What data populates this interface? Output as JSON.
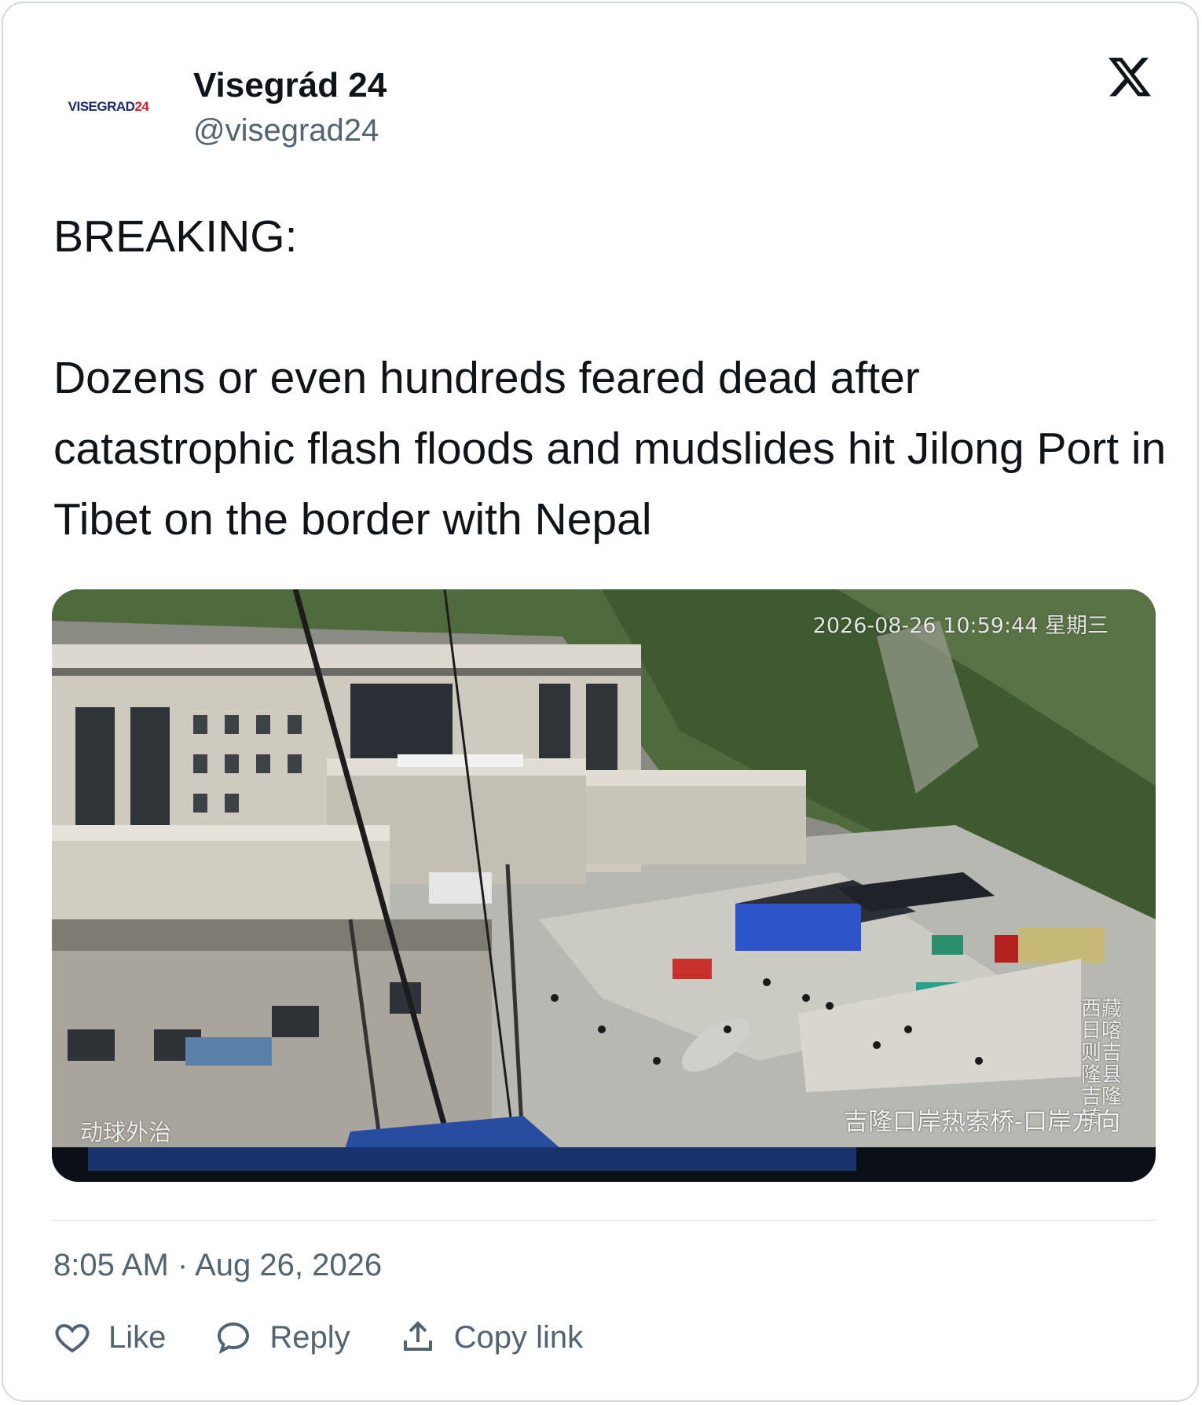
{
  "author": {
    "avatar_text": "VISEGRAD",
    "avatar_num": "24",
    "name": "Visegrád 24",
    "handle": "@visegrad24"
  },
  "platform_icon": "x-logo-icon",
  "tweet": {
    "line1": "BREAKING:",
    "line2": "Dozens or even hundreds feared dead after catastrophic flash floods and mudslides hit Jilong Port in Tibet on the border with Nepal"
  },
  "media": {
    "camera_timestamp": "2026-08-26 10:59:44 星期三",
    "label_left": "动球外治",
    "label_right": "吉隆口岸热索桥-口岸方向",
    "label_place": "西藏日喀则吉隆县吉隆镇",
    "progress": 0.72
  },
  "footer": {
    "timestamp": "8:05 AM · Aug 26, 2026"
  },
  "actions": {
    "like": "Like",
    "reply": "Reply",
    "copy_link": "Copy link"
  },
  "icons": [
    "heart-icon",
    "reply-icon",
    "share-icon"
  ],
  "colors": {
    "text": "#0f1419",
    "secondary": "#536471",
    "border": "#cfd9de"
  }
}
